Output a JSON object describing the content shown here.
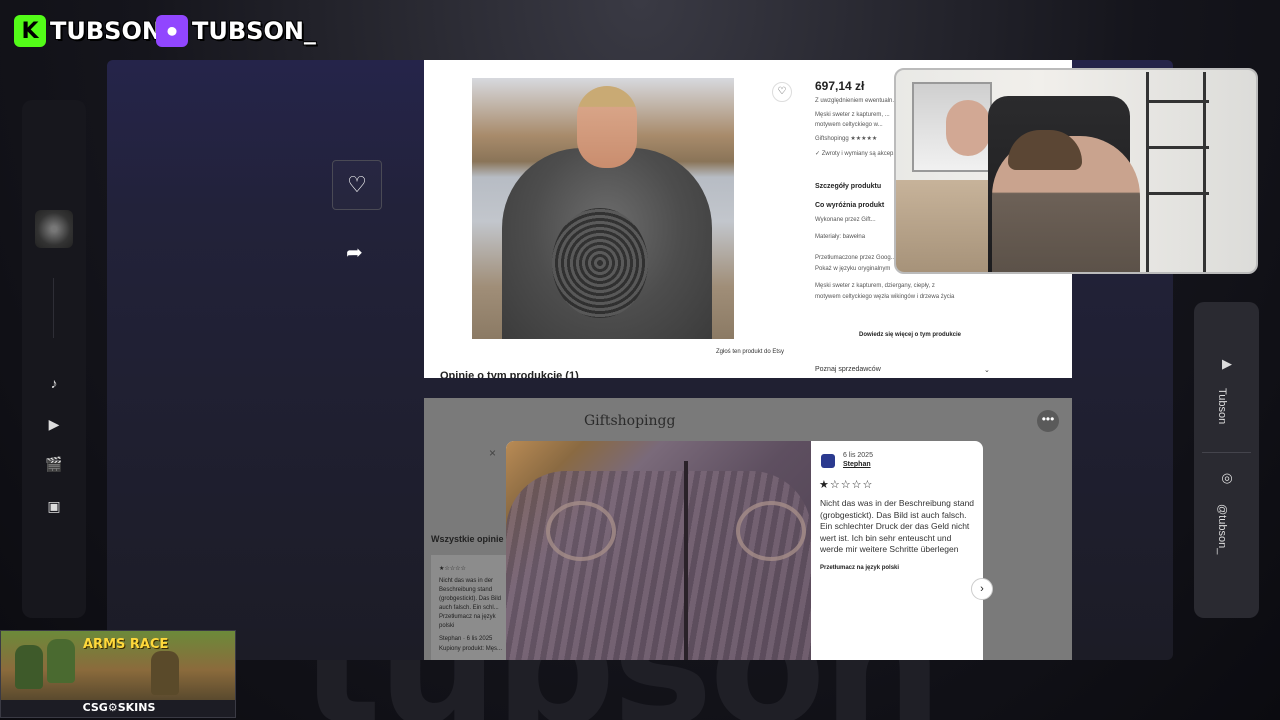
{
  "overlay": {
    "kick": {
      "logo": "K",
      "name": "TUBSON"
    },
    "twitch": {
      "logo": "⏺",
      "name": "TUBSON_"
    },
    "watermark": "tubson",
    "sponsor": {
      "title": "ARMS RACE",
      "sub": "CSG⚙SKINS"
    },
    "social": {
      "youtube": "Tubson",
      "instagram": "@tubson_"
    }
  },
  "product": {
    "price": "697,14 zł",
    "lines": [
      "Z uwzględnieniem ewentualn...",
      "Męski sweter z kapturem, ...",
      "motywem celtyckiego w...",
      "Giftshopingg ★★★★★",
      "✓ Zwroty i wymiany są akcep..."
    ],
    "details_title": "Szczegóły produktu",
    "what_title": "Co wyróżnia produkt",
    "made_by": "Wykonane przez Gift...",
    "material": "Materiały: bawełna",
    "translated": "Przetłumaczone przez Goog...",
    "show_original": "Pokaż w języku oryginalnym",
    "desc1": "Męski sweter z kapturem, dziergany, ciepły, z",
    "desc2": "motywem celtyckiego węzła wikingów i drzewa życia",
    "more_link": "Dowiedz się więcej o tym produkcie",
    "report": "Zgłoś ten produkt do Etsy",
    "reviews_heading": "Opinie o tym produkcie (1)",
    "seller": "Poznaj sprzedawców",
    "chevron": "⌄"
  },
  "reviews": {
    "shop_name": "Giftshopingg",
    "more": "•••",
    "all_reviews": "Wszystkie opinie",
    "bg_lines": [
      "★☆☆☆☆",
      "Nicht das was in der",
      "Beschreibung stand",
      "(grobgestickt). Das Bild",
      "auch falsch. Ein schl...",
      "Przetłumacz na język",
      "polski",
      "Stephan · 6 lis 2025",
      "Kupiony produkt: Męs..."
    ]
  },
  "modal": {
    "close": "×",
    "date": "6 lis 2025",
    "reviewer": "Stephan",
    "stars": "★☆☆☆☆",
    "text": "Nicht das was in der Beschreibung stand (grobgestickt). Das Bild ist auch falsch. Ein schlechter Druck der das Geld nicht wert ist. Ich bin sehr enteuscht und werde mir weitere Schritte überlegen",
    "translate": "Przetłumacz na język polski",
    "next": "›"
  },
  "icons": {
    "heart": "♡",
    "share": "➦",
    "music": "♪",
    "play": "▶",
    "clapper": "🎬",
    "image": "▣",
    "youtube": "▶",
    "instagram": "◎"
  },
  "colors": {
    "kick": "#53fc18",
    "twitch": "#9146ff",
    "star": "#222222"
  }
}
